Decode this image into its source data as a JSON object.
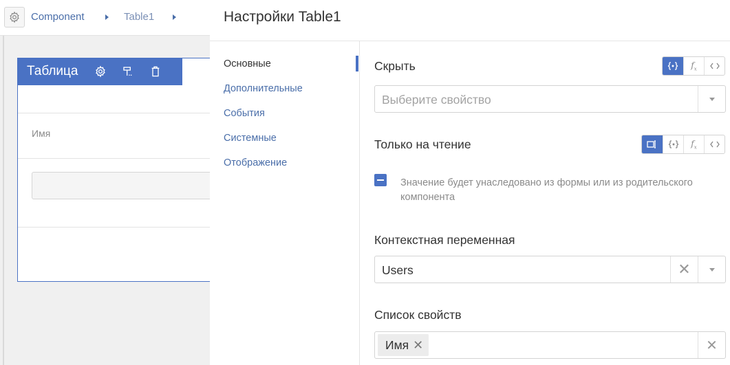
{
  "breadcrumb": {
    "items": [
      "Component",
      "Table1"
    ]
  },
  "canvas": {
    "table_title": "Таблица",
    "column_label": "Имя"
  },
  "modal": {
    "title": "Настройки Table1",
    "nav": [
      "Основные",
      "Дополнительные",
      "События",
      "Системные",
      "Отображение"
    ],
    "active_nav": "Основные",
    "hide": {
      "label": "Скрыть",
      "placeholder": "Выберите свойство",
      "modes": [
        "{·}",
        "fx",
        "<>"
      ],
      "active_mode": "{·}"
    },
    "readonly": {
      "label": "Только на чтение",
      "modes": [
        "toggle",
        "{·}",
        "fx",
        "<>"
      ],
      "active_mode": "toggle",
      "checkbox_state": "indeterminate",
      "hint": "Значение будет унаследовано из формы или из родительского компонента"
    },
    "context_var": {
      "label": "Контекстная переменная",
      "value": "Users"
    },
    "properties": {
      "label": "Список свойств",
      "tags": [
        "Имя"
      ]
    }
  },
  "colors": {
    "accent": "#4a72c4",
    "link": "#4a6ea9"
  }
}
